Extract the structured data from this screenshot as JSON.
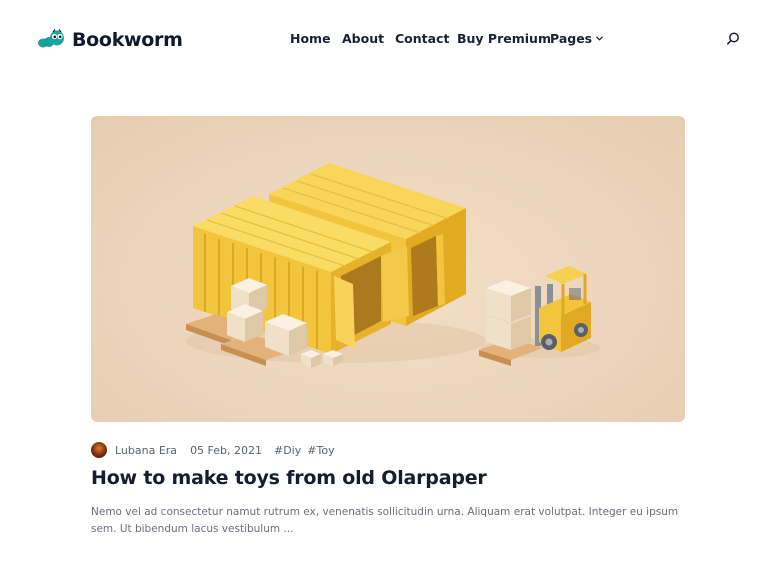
{
  "brand": {
    "name": "Bookworm",
    "logo_icon": "bookworm-logo-icon",
    "accent": "#1aa59a"
  },
  "nav": {
    "items": [
      {
        "label": "Home"
      },
      {
        "label": "About"
      },
      {
        "label": "Contact"
      },
      {
        "label": "Buy Premium"
      },
      {
        "label": "Pages",
        "icon": "chevron-down-icon"
      }
    ],
    "search_icon": "search-icon"
  },
  "post": {
    "image_alt_icon": "shipping-containers-illustration",
    "author": "Lubana Era",
    "date": "05 Feb, 2021",
    "tags": [
      "#Diy",
      "#Toy"
    ],
    "title": "How to make toys from old Olarpaper",
    "excerpt": "Nemo vel ad consectetur namut rutrum ex, venenatis sollicitudin urna. Aliquam erat volutpat. Integer eu ipsum sem. Ut bibendum lacus vestibulum ..."
  },
  "colors": {
    "heading": "#151d2e",
    "body_text": "#6a6f7b",
    "hero_bg": "#ecd5bb",
    "container_yellow": "#f2c53d"
  }
}
